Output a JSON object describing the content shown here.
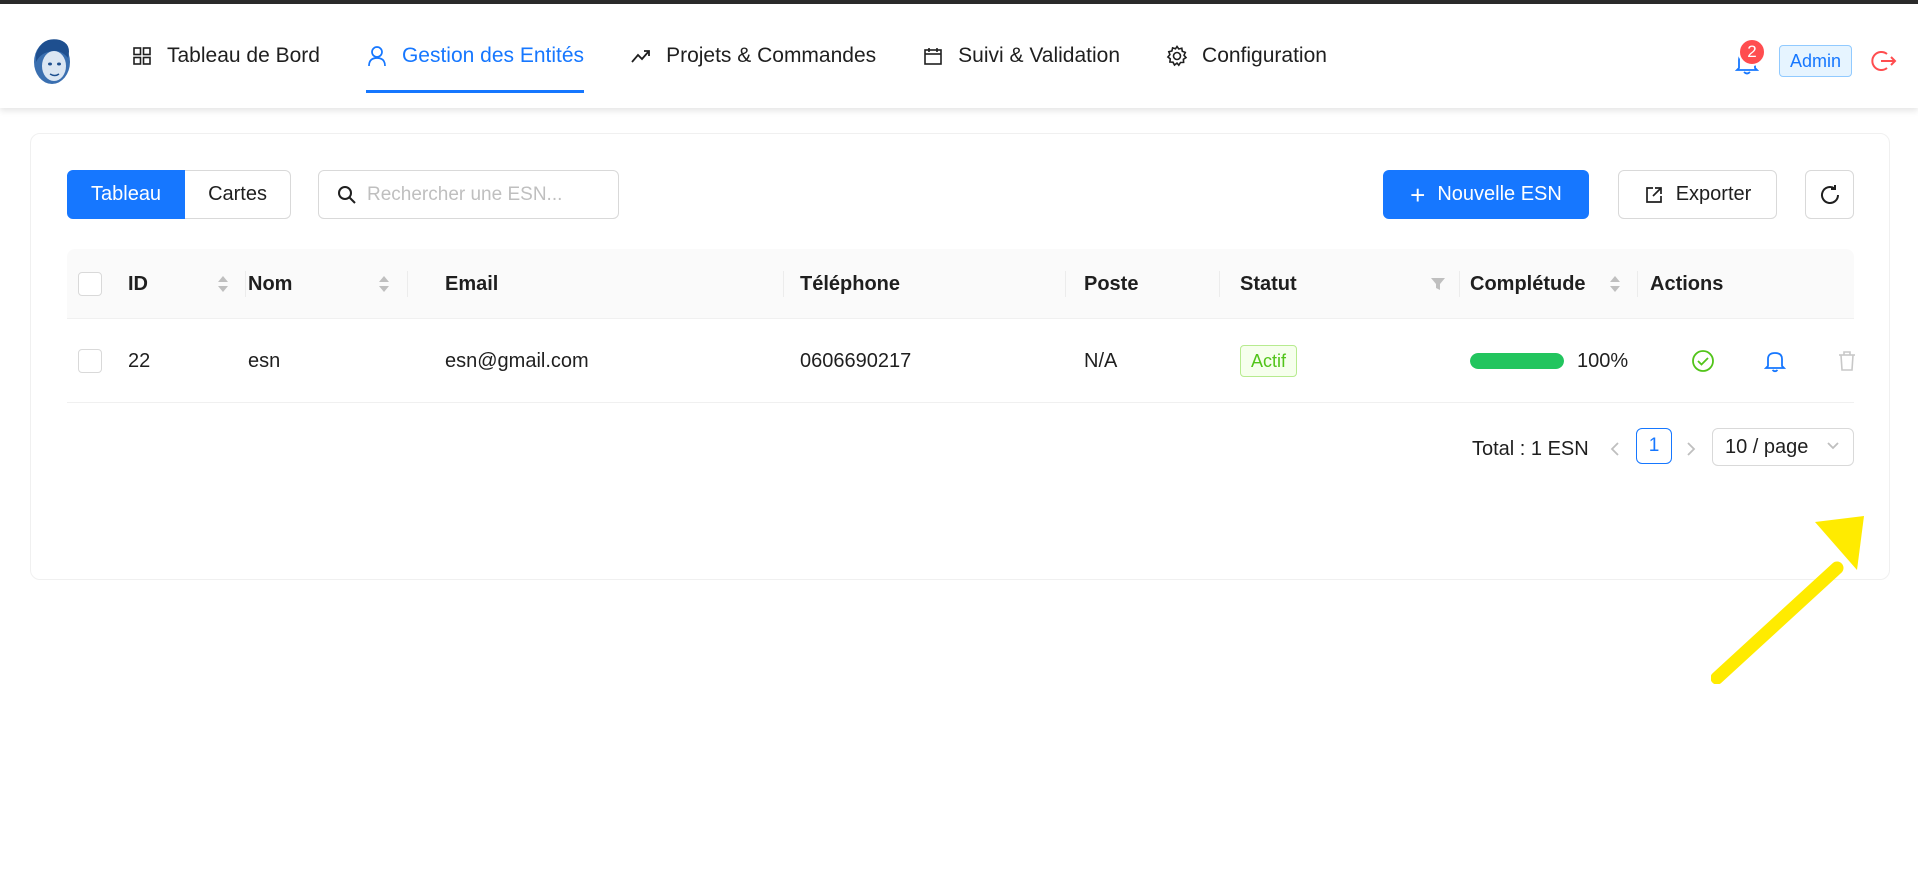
{
  "header": {
    "nav": [
      {
        "label": "Tableau de Bord",
        "icon": "grid-icon"
      },
      {
        "label": "Gestion des Entités",
        "icon": "user-icon",
        "active": true
      },
      {
        "label": "Projets & Commandes",
        "icon": "trend-icon"
      },
      {
        "label": "Suivi & Validation",
        "icon": "calendar-icon"
      },
      {
        "label": "Configuration",
        "icon": "gear-icon"
      }
    ],
    "notification_count": "2",
    "user_role": "Admin"
  },
  "toolbar": {
    "view_tabs": [
      "Tableau",
      "Cartes"
    ],
    "active_view": "Tableau",
    "search_placeholder": "Rechercher une ESN...",
    "search_value": "",
    "new_button": "Nouvelle ESN",
    "export_button": "Exporter"
  },
  "table": {
    "columns": [
      "ID",
      "Nom",
      "Email",
      "Téléphone",
      "Poste",
      "Statut",
      "Complétude",
      "Actions"
    ],
    "rows": [
      {
        "id": "22",
        "nom": "esn",
        "email": "esn@gmail.com",
        "telephone": "0606690217",
        "poste": "N/A",
        "statut": "Actif",
        "completude": "100%",
        "completude_value": 100
      }
    ]
  },
  "pagination": {
    "total": "Total : 1 ESN",
    "current_page": "1",
    "page_size": "10 / page"
  },
  "colors": {
    "primary": "#1677ff",
    "success": "#52c41a",
    "progress": "#22c55e",
    "danger": "#ff4d4f",
    "annotation_arrow": "#ffeb00"
  }
}
